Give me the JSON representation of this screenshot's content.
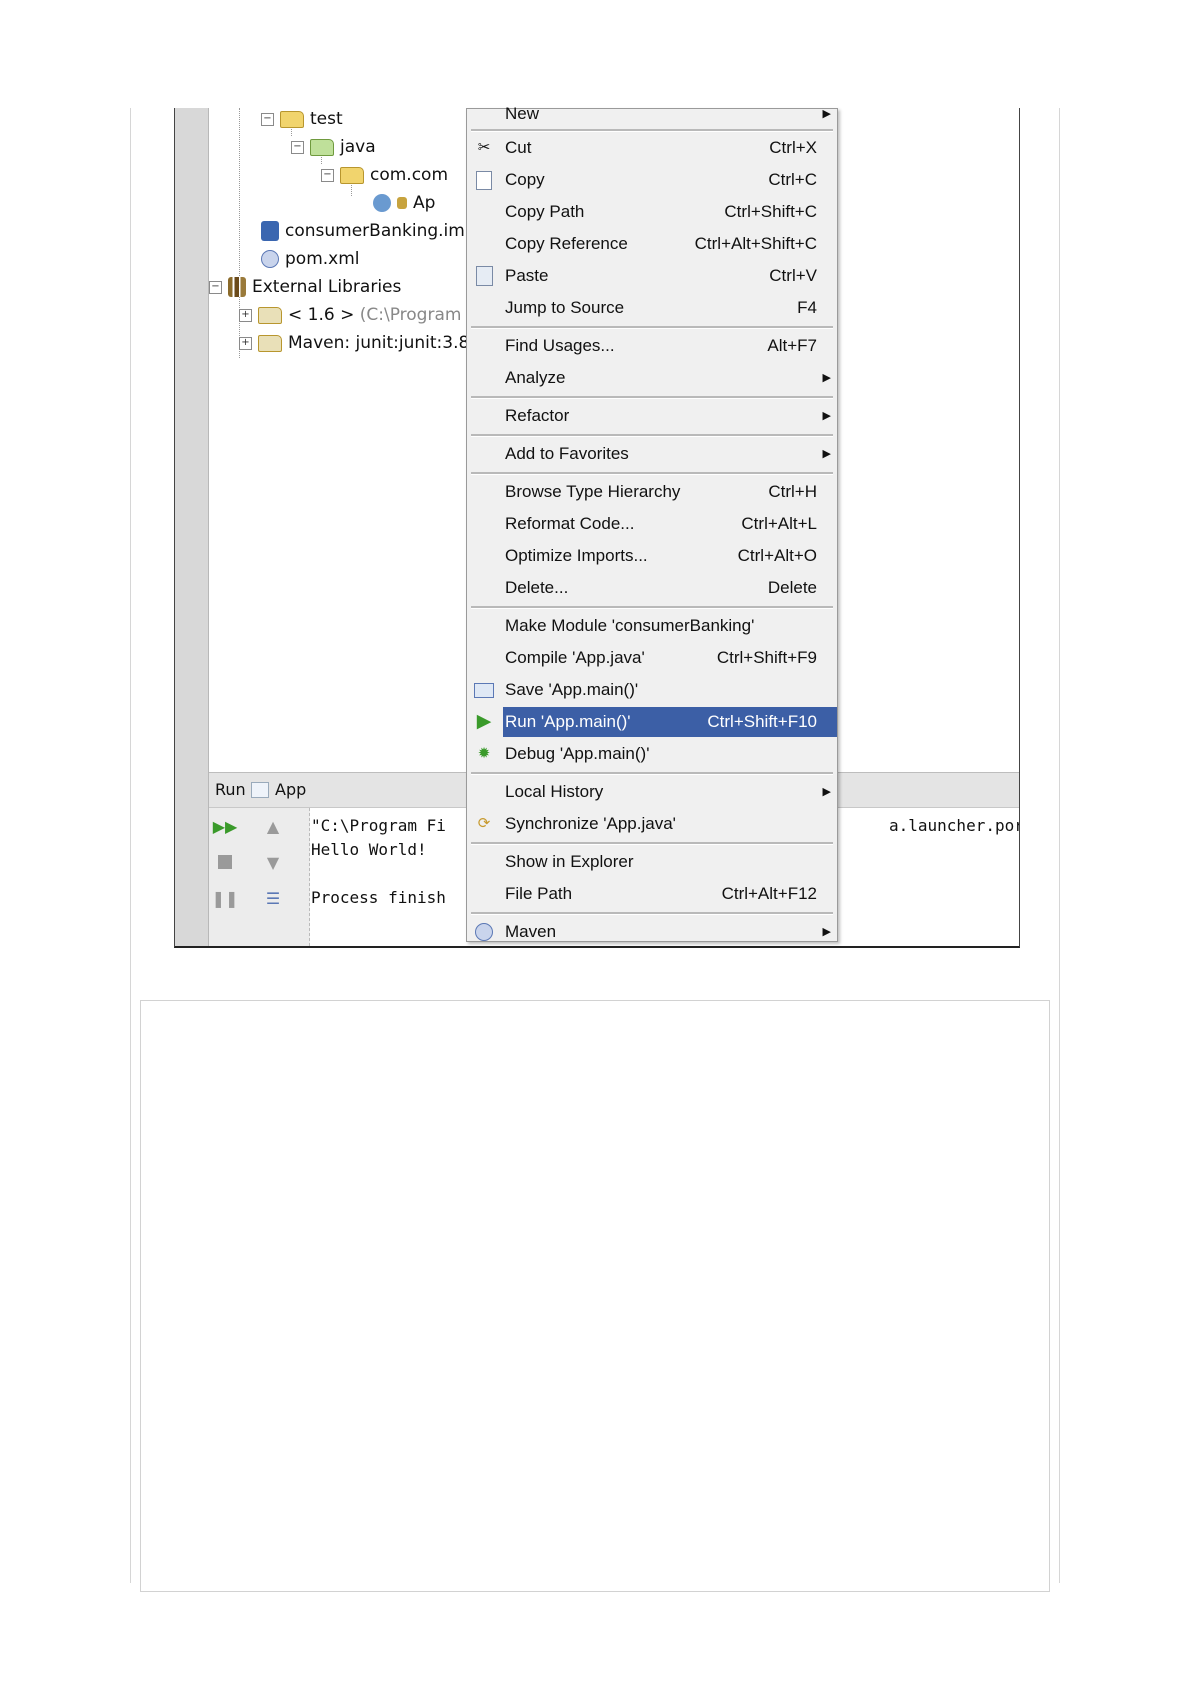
{
  "tree": {
    "items": [
      {
        "label": "test"
      },
      {
        "label": "java"
      },
      {
        "label": "com.com"
      },
      {
        "label": "Ap"
      },
      {
        "label": "consumerBanking.im"
      },
      {
        "label": "pom.xml"
      },
      {
        "label": "External Libraries"
      },
      {
        "label": "< 1.6 >",
        "extra": "(C:\\Program"
      },
      {
        "label": "Maven: junit:junit:3.8"
      }
    ]
  },
  "run_panel": {
    "title": "Run",
    "tab": "App",
    "console": [
      "\"C:\\Program Fi",
      "Hello World!",
      "Process finish"
    ],
    "console_right": "a.launcher.port="
  },
  "menu": {
    "items": [
      {
        "label": "New",
        "shortcut": "",
        "icon": "",
        "submenu": true
      },
      {
        "label": "Cut",
        "shortcut": "Ctrl+X",
        "icon": "scissors-icon",
        "submenu": false
      },
      {
        "label": "Copy",
        "shortcut": "Ctrl+C",
        "icon": "copy-icon",
        "submenu": false
      },
      {
        "label": "Copy Path",
        "shortcut": "Ctrl+Shift+C",
        "icon": "",
        "submenu": false
      },
      {
        "label": "Copy Reference",
        "shortcut": "Ctrl+Alt+Shift+C",
        "icon": "",
        "submenu": false
      },
      {
        "label": "Paste",
        "shortcut": "Ctrl+V",
        "icon": "paste-icon",
        "submenu": false
      },
      {
        "label": "Jump to Source",
        "shortcut": "F4",
        "icon": "",
        "submenu": false
      },
      {
        "label": "Find Usages...",
        "shortcut": "Alt+F7",
        "icon": "",
        "submenu": false
      },
      {
        "label": "Analyze",
        "shortcut": "",
        "icon": "",
        "submenu": true
      },
      {
        "label": "Refactor",
        "shortcut": "",
        "icon": "",
        "submenu": true
      },
      {
        "label": "Add to Favorites",
        "shortcut": "",
        "icon": "",
        "submenu": true
      },
      {
        "label": "Browse Type Hierarchy",
        "shortcut": "Ctrl+H",
        "icon": "",
        "submenu": false
      },
      {
        "label": "Reformat Code...",
        "shortcut": "Ctrl+Alt+L",
        "icon": "",
        "submenu": false
      },
      {
        "label": "Optimize Imports...",
        "shortcut": "Ctrl+Alt+O",
        "icon": "",
        "submenu": false
      },
      {
        "label": "Delete...",
        "shortcut": "Delete",
        "icon": "",
        "submenu": false
      },
      {
        "label": "Make Module 'consumerBanking'",
        "shortcut": "",
        "icon": "",
        "submenu": false
      },
      {
        "label": "Compile 'App.java'",
        "shortcut": "Ctrl+Shift+F9",
        "icon": "",
        "submenu": false
      },
      {
        "label": "Save 'App.main()'",
        "shortcut": "",
        "icon": "save-config-icon",
        "submenu": false
      },
      {
        "label": "Run 'App.main()'",
        "shortcut": "Ctrl+Shift+F10",
        "icon": "run-icon",
        "submenu": false,
        "highlighted": true
      },
      {
        "label": "Debug 'App.main()'",
        "shortcut": "",
        "icon": "debug-icon",
        "submenu": false
      },
      {
        "label": "Local History",
        "shortcut": "",
        "icon": "",
        "submenu": true
      },
      {
        "label": "Synchronize 'App.java'",
        "shortcut": "",
        "icon": "sync-icon",
        "submenu": false
      },
      {
        "label": "Show in Explorer",
        "shortcut": "",
        "icon": "",
        "submenu": false
      },
      {
        "label": "File Path",
        "shortcut": "Ctrl+Alt+F12",
        "icon": "",
        "submenu": false
      },
      {
        "label": "Maven",
        "shortcut": "",
        "icon": "maven-icon",
        "submenu": true
      }
    ]
  },
  "colors": {
    "highlight": "#3c5fa6",
    "menu_bg": "#f0f0f0",
    "run_icon": "#3a9a2a"
  }
}
